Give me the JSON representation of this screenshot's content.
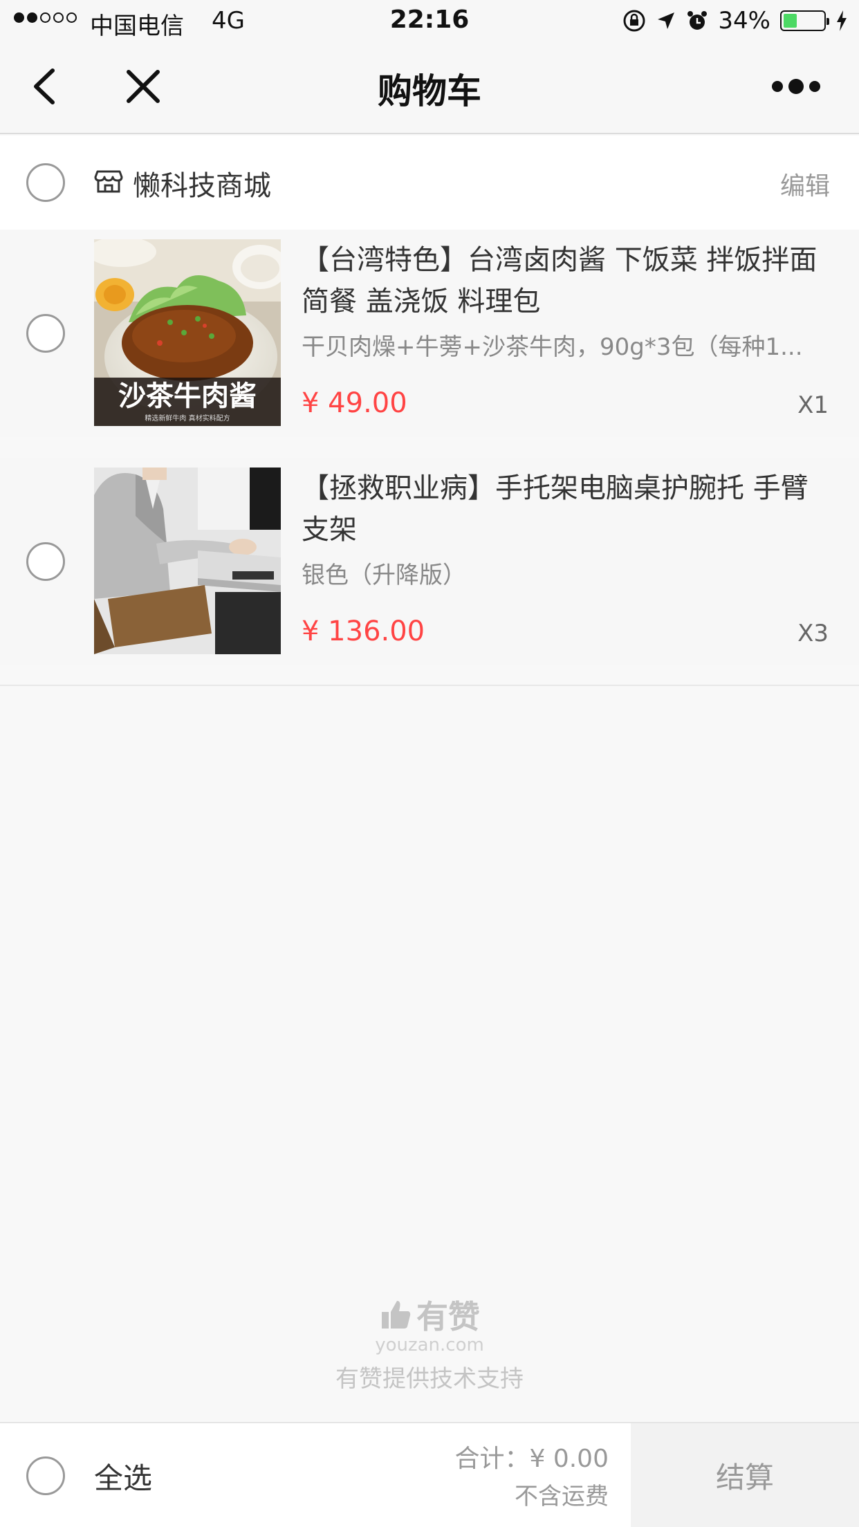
{
  "status_bar": {
    "carrier": "中国电信",
    "network": "4G",
    "time": "22:16",
    "battery_percent": "34%",
    "battery_level": 0.34,
    "battery_color": "#4cd964"
  },
  "navbar": {
    "title": "购物车",
    "back_icon": "chevron-left-icon",
    "close_icon": "close-icon",
    "more_icon": "more-icon"
  },
  "shop": {
    "name": "懒科技商城",
    "edit_label": "编辑",
    "icon": "store-icon"
  },
  "items": [
    {
      "title": "【台湾特色】台湾卤肉酱 下饭菜 拌饭拌面 简餐 盖浇饭 料理包",
      "sku": "干贝肉燥+牛蒡+沙茶牛肉，90g*3包（每种1...",
      "price": "¥ 49.00",
      "quantity": "X1",
      "image_text": "沙茶牛肉酱",
      "image_subtext": "精选新鲜牛肉 真材实料配方"
    },
    {
      "title": "【拯救职业病】手托架电脑桌护腕托 手臂支架",
      "sku": "银色（升降版）",
      "price": "¥ 136.00",
      "quantity": "X3"
    }
  ],
  "branding": {
    "name": "有赞",
    "domain": "youzan.com",
    "support": "有赞提供技术支持"
  },
  "footer": {
    "select_all_label": "全选",
    "total": "合计：¥ 0.00",
    "shipping_note": "不含运费",
    "checkout_label": "结算"
  },
  "colors": {
    "price": "#ff4444",
    "accent": "#ff4444"
  }
}
